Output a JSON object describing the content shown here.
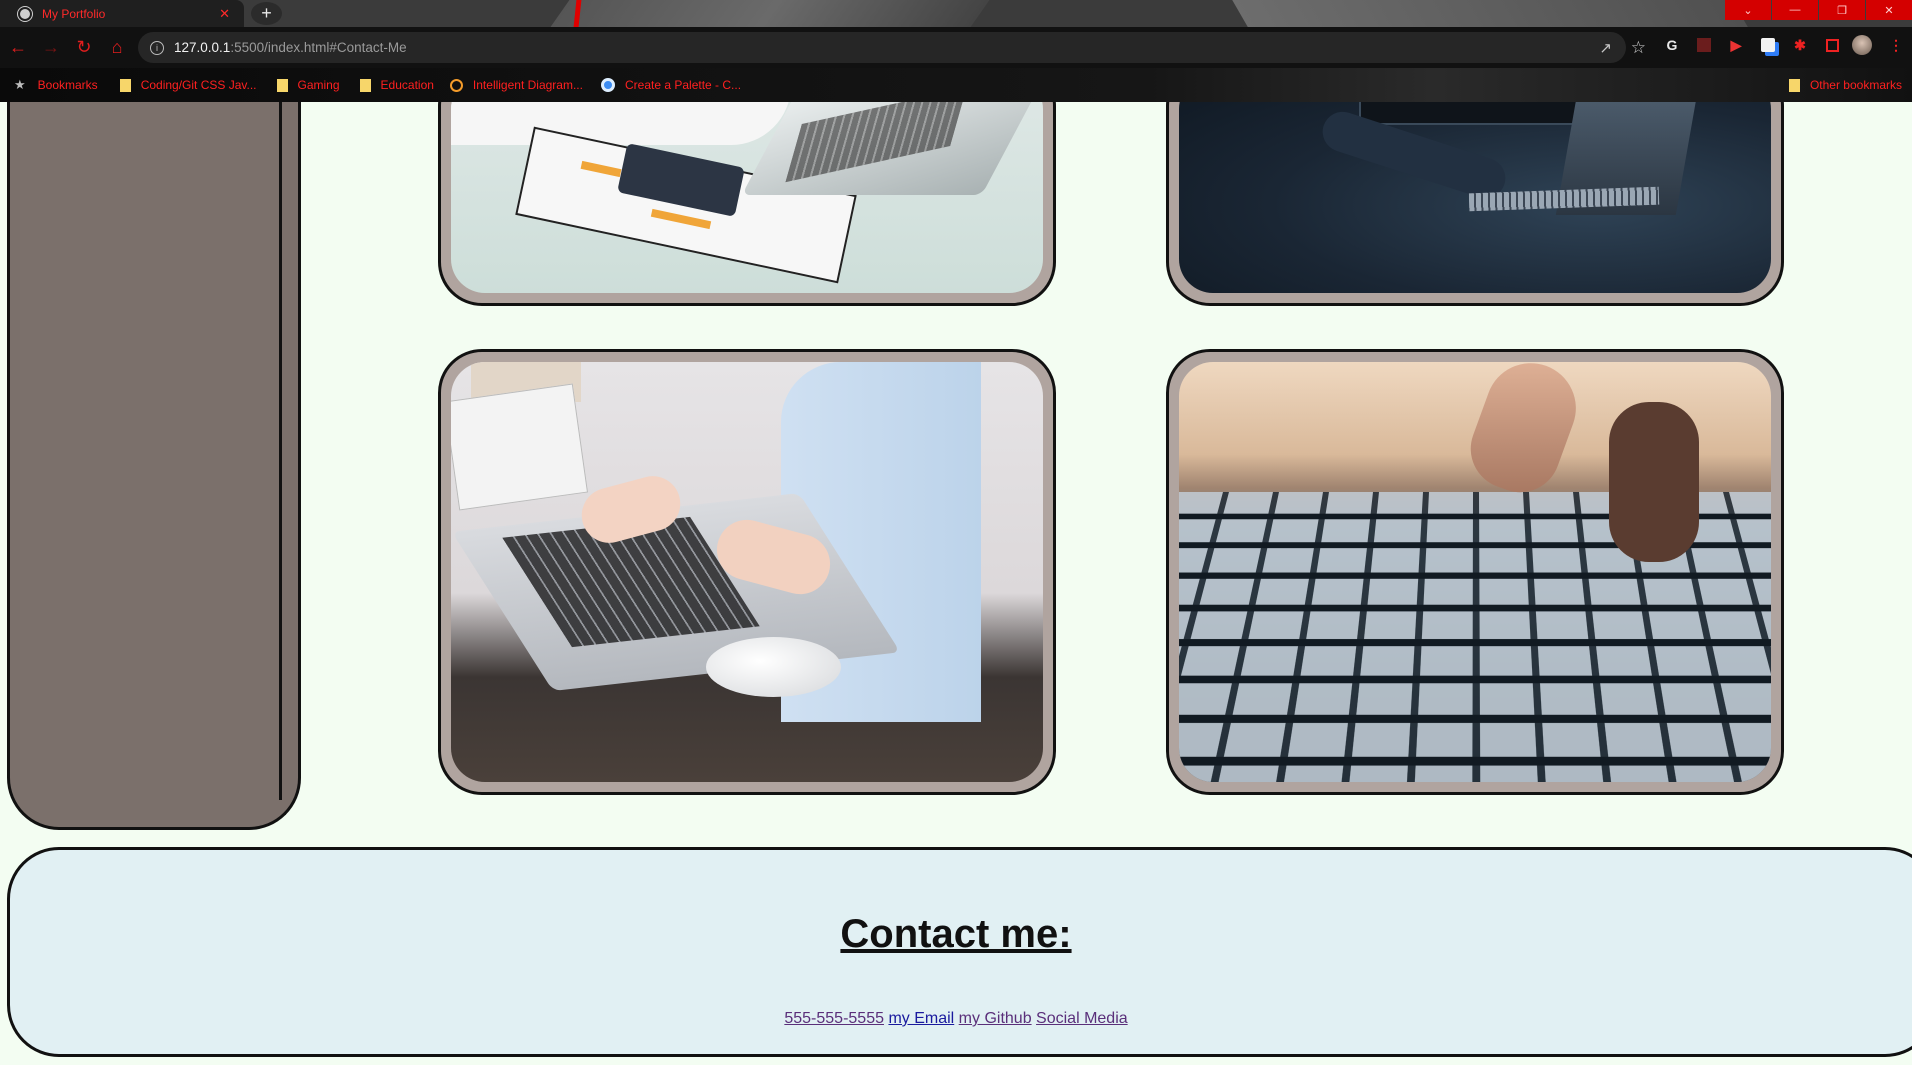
{
  "browser": {
    "tab_title": "My Portfolio",
    "tab_close": "✕",
    "new_tab": "+",
    "window_controls": [
      "⌄",
      "—",
      "❐",
      "✕"
    ],
    "url_host": "127.0.0.1",
    "url_rest": ":5500/index.html#Contact-Me",
    "bookmarks": [
      {
        "label": "Bookmarks",
        "icon": "star-icon"
      },
      {
        "label": "Coding/Git CSS Jav...",
        "icon": "folder-icon"
      },
      {
        "label": "Gaming",
        "icon": "folder-icon"
      },
      {
        "label": "Education",
        "icon": "folder-icon"
      },
      {
        "label": "Intelligent Diagram...",
        "icon": "spark-icon"
      },
      {
        "label": "Create a Palette - C...",
        "icon": "globe-icon"
      }
    ],
    "other_bookmarks": "Other bookmarks"
  },
  "contact": {
    "heading": "Contact me:",
    "phone": "555-555-5555",
    "email": "my Email",
    "github": "my Github",
    "social": "Social Media"
  },
  "colors": {
    "page_bg": "#f3fdf2",
    "sidebar": "#7b706b",
    "card_frame": "#b0a49f",
    "contact_bg": "#e1f0f3",
    "accent_red": "#ff2020"
  }
}
